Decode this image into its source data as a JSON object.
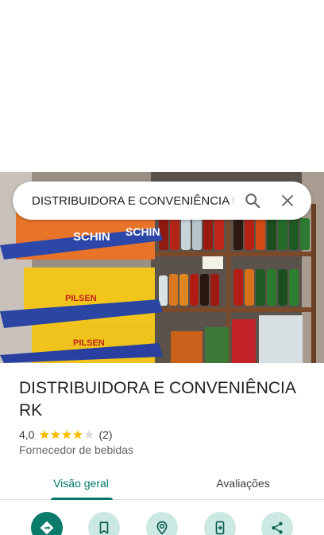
{
  "search": {
    "query": "DISTRIBUIDORA E CONVENIÊNCIA RK"
  },
  "photo": {
    "signs": [
      "SCHIN",
      "SCHIN",
      "PILSEN",
      "PILSEN"
    ]
  },
  "place": {
    "name": "DISTRIBUIDORA E CONVENIÊNCIA RK",
    "rating": "4,0",
    "rating_value": 4.0,
    "rating_max": 5,
    "review_count": "(2)",
    "category": "Fornecedor de bebidas"
  },
  "tabs": [
    {
      "label": "Visão geral",
      "active": true
    },
    {
      "label": "Avaliações",
      "active": false
    }
  ],
  "actions": [
    {
      "icon": "directions-icon"
    },
    {
      "icon": "bookmark-icon"
    },
    {
      "icon": "nearby-icon"
    },
    {
      "icon": "send-to-phone-icon"
    },
    {
      "icon": "share-icon"
    }
  ],
  "colors": {
    "accent": "#00796b",
    "action_bg": "#cbe8e2",
    "primary_action": "#0b7b6c",
    "star": "#fbbc04"
  }
}
